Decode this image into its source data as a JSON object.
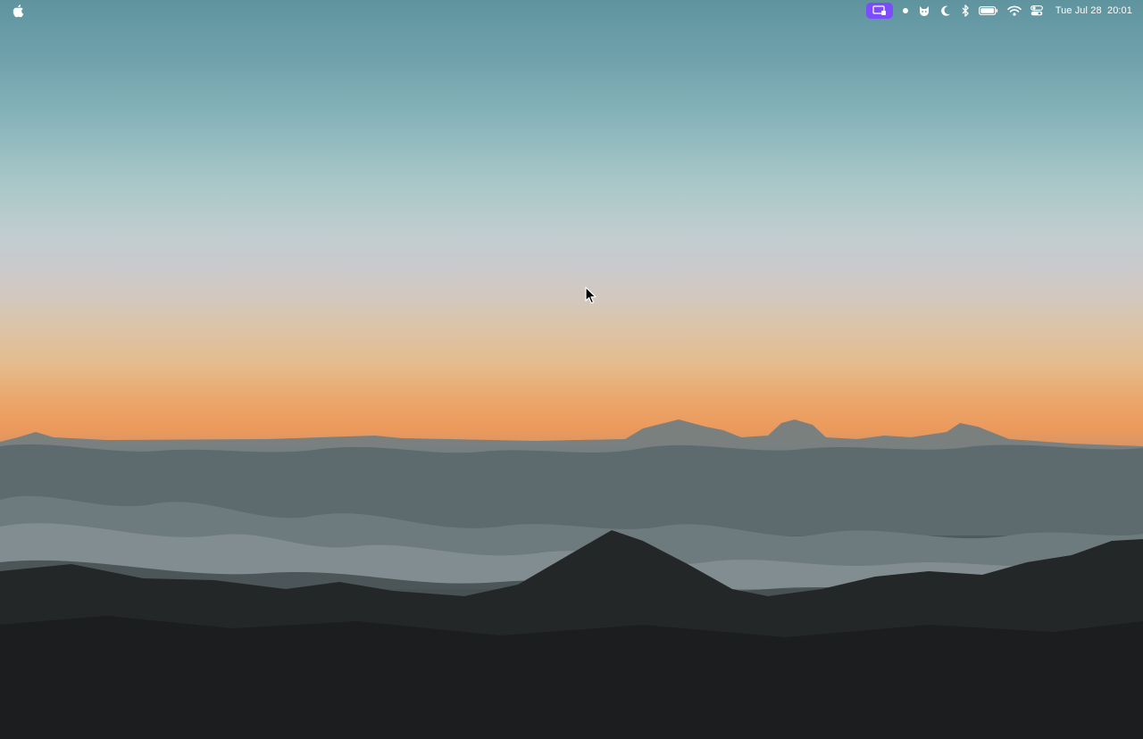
{
  "menubar": {
    "apple_icon": "apple-logo-icon",
    "status_items": [
      {
        "name": "screen-sharing-icon",
        "highlighted": true,
        "color": "#7b4dff"
      },
      {
        "name": "record-dot-icon"
      },
      {
        "name": "cat-icon"
      },
      {
        "name": "focus-moon-icon"
      },
      {
        "name": "bluetooth-icon"
      },
      {
        "name": "battery-icon"
      },
      {
        "name": "wifi-icon"
      },
      {
        "name": "control-center-icon"
      }
    ],
    "clock": "Tue Jul 28  20:01"
  },
  "desktop": {
    "wallpaper": "sunset-above-clouds",
    "cursor": "arrow-cursor"
  }
}
